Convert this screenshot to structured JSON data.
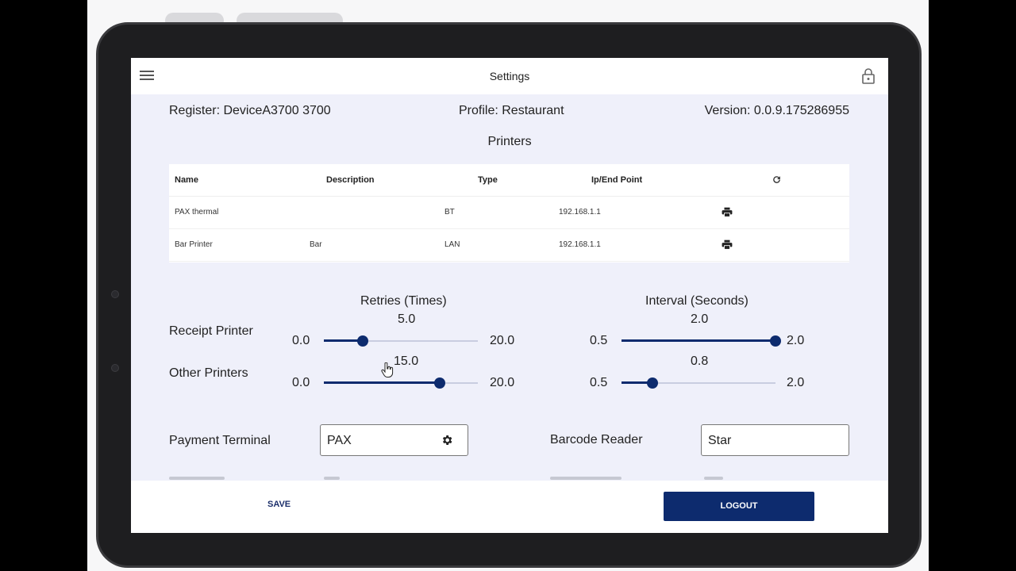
{
  "app": {
    "title": "Settings",
    "menu_icon": "hamburger-menu-icon",
    "lock_icon": "lock-icon"
  },
  "info": {
    "register": "Register: DeviceA3700 3700",
    "profile": "Profile: Restaurant",
    "version": "Version: 0.0.9.175286955"
  },
  "printers": {
    "title": "Printers",
    "columns": [
      "Name",
      "Description",
      "Type",
      "Ip/End Point"
    ],
    "rows": [
      {
        "name": "PAX thermal",
        "description": "",
        "type": "BT",
        "ip": "192.168.1.1"
      },
      {
        "name": "Bar Printer",
        "description": "Bar",
        "type": "LAN",
        "ip": "192.168.1.1"
      }
    ]
  },
  "settings": {
    "retries_title": "Retries (Times)",
    "interval_title": "Interval (Seconds)",
    "receipt_label": "Receipt Printer",
    "other_label": "Other Printers",
    "receipt_retries": {
      "value": "5.0",
      "min": "0.0",
      "max": "20.0",
      "current": 5.0,
      "range": [
        0,
        20
      ]
    },
    "other_retries": {
      "value": "15.0",
      "min": "0.0",
      "max": "20.0",
      "current": 15.0,
      "range": [
        0,
        20
      ]
    },
    "receipt_interval": {
      "value": "2.0",
      "min": "0.5",
      "max": "2.0",
      "current": 2.0,
      "range": [
        0.5,
        2.0
      ]
    },
    "other_interval": {
      "value": "0.8",
      "min": "0.5",
      "max": "2.0",
      "current": 0.8,
      "range": [
        0.5,
        2.0
      ]
    }
  },
  "devices": {
    "payment_label": "Payment Terminal",
    "payment_value": "PAX",
    "barcode_label": "Barcode Reader",
    "barcode_value": "Star"
  },
  "actions": {
    "save": "SAVE",
    "logout": "LOGOUT"
  },
  "colors": {
    "primary": "#0d2b6e",
    "background": "#eff0fa"
  }
}
